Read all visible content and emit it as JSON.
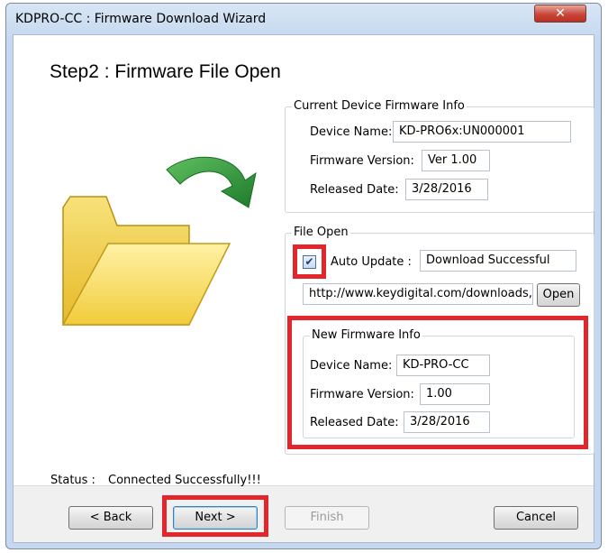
{
  "window": {
    "title": "KDPRO-CC : Firmware Download Wizard",
    "close_glyph": "✕"
  },
  "step_title": "Step2 : Firmware File Open",
  "current_info": {
    "legend": "Current Device Firmware Info",
    "device_name_label": "Device Name:",
    "device_name_value": "KD-PRO6x:UN000001",
    "fw_version_label": "Firmware Version:",
    "fw_version_value": "Ver 1.00",
    "released_label": "Released Date:",
    "released_value": "3/28/2016"
  },
  "file_open": {
    "legend": "File Open",
    "auto_update_label": "Auto Update :",
    "auto_update_checked": true,
    "auto_update_status": "Download Successful",
    "url_value": "http://www.keydigital.com/downloads,",
    "open_button": "Open"
  },
  "new_info": {
    "legend": "New Firmware Info",
    "device_name_label": "Device Name:",
    "device_name_value": "KD-PRO-CC",
    "fw_version_label": "Firmware Version:",
    "fw_version_value": "1.00",
    "released_label": "Released Date:",
    "released_value": "3/28/2016"
  },
  "status": {
    "label": "Status :",
    "value": "Connected Successfully!!!"
  },
  "buttons": {
    "back": "< Back",
    "next": "Next >",
    "finish": "Finish",
    "cancel": "Cancel"
  },
  "colors": {
    "highlight": "#e3262b",
    "folder": "#f3d34a",
    "arrow": "#2e8a3a"
  }
}
